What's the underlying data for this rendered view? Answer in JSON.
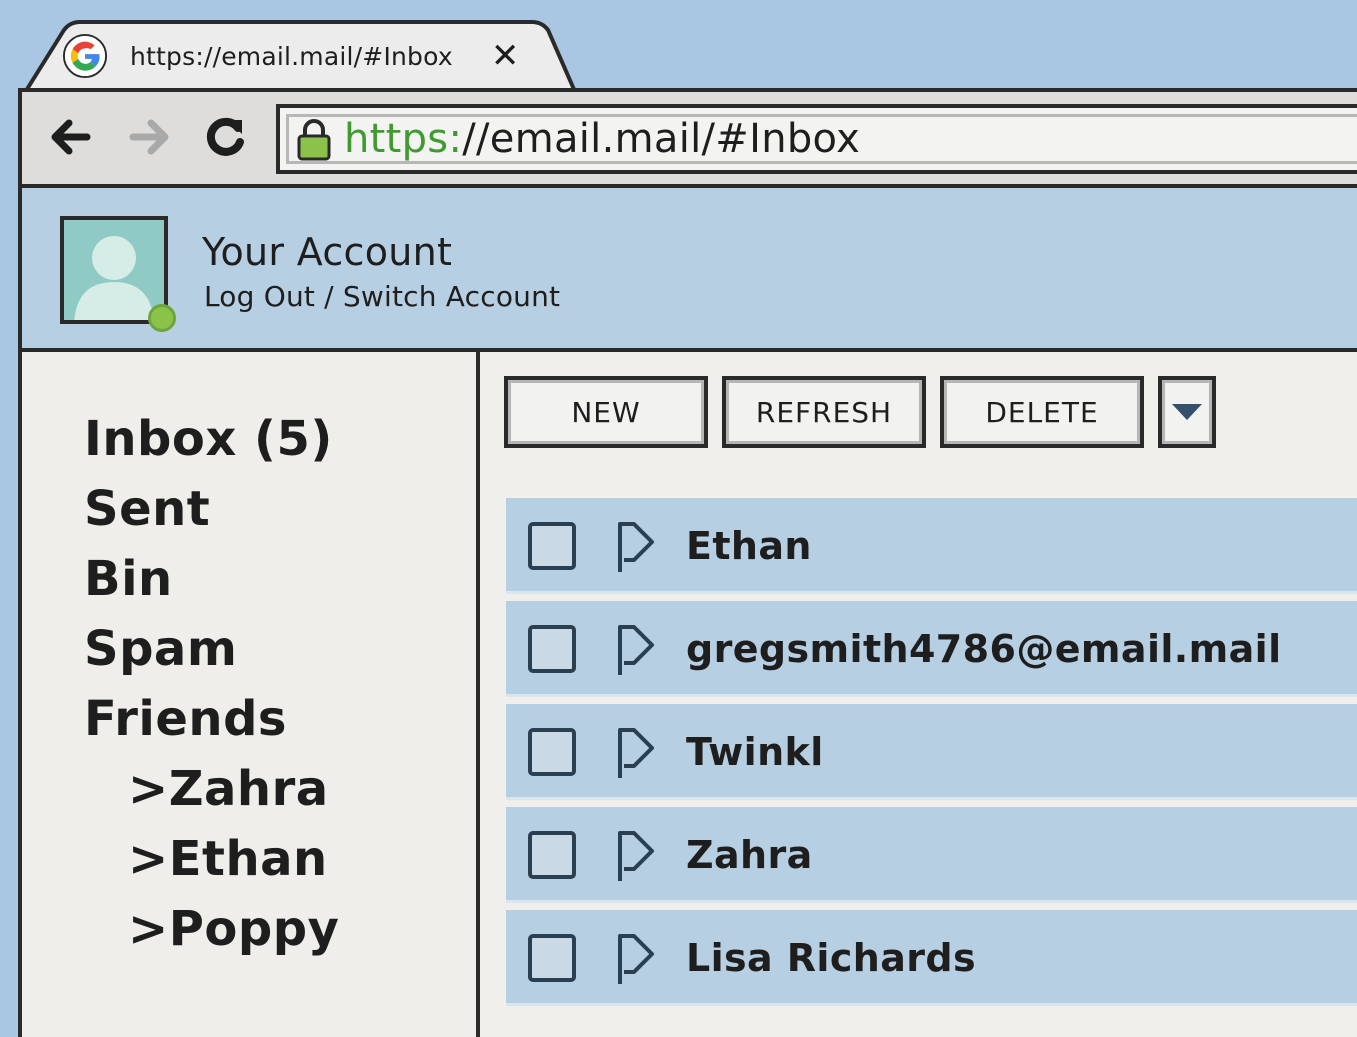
{
  "tab": {
    "title": "https://email.mail/#Inbox",
    "close_label": "✕"
  },
  "browser": {
    "url_scheme": "https:",
    "url_rest": "//email.mail/#Inbox",
    "back_icon": "arrow-left-icon",
    "forward_icon": "arrow-right-icon",
    "reload_icon": "reload-icon",
    "lock_icon": "lock-icon"
  },
  "account": {
    "name": "Your Account",
    "links": "Log Out / Switch Account",
    "status_color": "#8bc34a"
  },
  "sidebar": {
    "folders": [
      {
        "label": "Inbox (5)"
      },
      {
        "label": "Sent"
      },
      {
        "label": "Bin"
      },
      {
        "label": "Spam"
      },
      {
        "label": "Friends"
      },
      {
        "label": ">Zahra"
      },
      {
        "label": ">Ethan"
      },
      {
        "label": ">Poppy"
      }
    ]
  },
  "toolbar": {
    "new_label": "NEW",
    "refresh_label": "REFRESH",
    "delete_label": "DELETE"
  },
  "messages": [
    {
      "sender": "Ethan"
    },
    {
      "sender": "gregsmith4786@email.mail"
    },
    {
      "sender": "Twinkl"
    },
    {
      "sender": "Zahra"
    },
    {
      "sender": "Lisa Richards"
    }
  ],
  "colors": {
    "background": "#a9c6e3",
    "row": "#b7cfe3",
    "url_scheme": "#3f9b2f"
  }
}
